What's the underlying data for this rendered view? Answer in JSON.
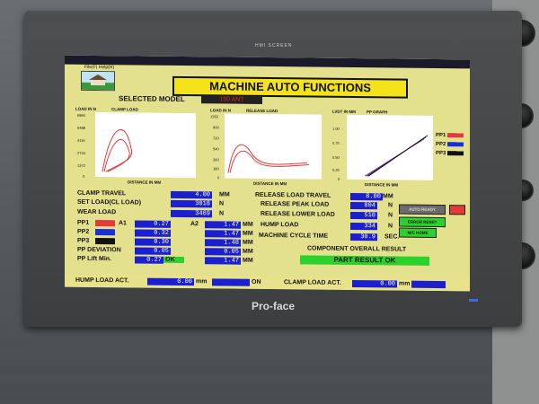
{
  "bezel_label": "HMI SCREEN",
  "brand": "Pro-face",
  "menu": "File(F)   Help(H)",
  "title": "MACHINE AUTO FUNCTIONS",
  "selected_model": {
    "label": "SELECTED MODEL",
    "value": "150 ANT"
  },
  "charts": [
    {
      "label": "CLAMP LOAD",
      "y_unit": "LOAD IN N",
      "x_label": "DISTANCE IN MM",
      "ticks": [
        "6860",
        "5488",
        "4116",
        "2744",
        "1372",
        "0"
      ]
    },
    {
      "label": "RELEASE LOAD",
      "y_unit": "LOAD IN N",
      "x_label": "DISTANCE IN MM",
      "ticks": [
        "1350",
        "900",
        "720",
        "540",
        "360",
        "180",
        "0"
      ]
    },
    {
      "label": "PP GRAPH",
      "y_unit": "LVDT IN MM",
      "x_label": "DISTANCE IN MM",
      "ticks": [
        "1.00",
        "0.75",
        "0.50",
        "0.25",
        "0"
      ]
    }
  ],
  "pp_legend": [
    "PP1",
    "PP2",
    "PP3"
  ],
  "left_fields": [
    {
      "label": "CLAMP TRAVEL",
      "value": "4.00",
      "unit": "MM"
    },
    {
      "label": "SET LOAD(CL LOAD)",
      "value": "3018",
      "unit": "N"
    },
    {
      "label": "WEAR LOAD",
      "value": "3469",
      "unit": "N"
    }
  ],
  "pp_rows": [
    {
      "label": "PP1",
      "a_label": "A1",
      "a_value": "0.27",
      "b_label": "A2",
      "b_value": "1.47",
      "unit": "MM"
    },
    {
      "label": "PP2",
      "a_value": "0.32",
      "b_value": "1.47",
      "unit": "MM"
    },
    {
      "label": "PP3",
      "a_value": "0.30",
      "b_value": "1.48",
      "unit": "MM"
    }
  ],
  "pp_deviation": {
    "label": "PP DEVIATION",
    "value": "0.05",
    "value2": "0.05",
    "unit": "MM"
  },
  "pp_lift": {
    "label": "PP Lift Min.",
    "value": "0.27",
    "status": "OK",
    "value2": "1.47",
    "unit": "MM"
  },
  "right_fields": [
    {
      "label": "RELEASE LOAD TRAVEL",
      "value": "8.00",
      "unit": "MM"
    },
    {
      "label": "RELEASE PEAK LOAD",
      "value": "804",
      "unit": "N"
    },
    {
      "label": "RELEASE LOWER LOAD",
      "value": "510",
      "unit": "N"
    },
    {
      "label": "HUMP LOAD",
      "value": "334",
      "unit": "N"
    },
    {
      "label": "MACHINE CYCLE TIME",
      "value": "30.9",
      "unit": "SEC."
    }
  ],
  "buttons": {
    "auto_ready": "AUTO READY",
    "error_reset": "ERROR RESET",
    "mc_home": "M/C HOME"
  },
  "component_result": {
    "label": "COMPONENT OVERALL RESULT",
    "value": "PART RESULT OK"
  },
  "footer": {
    "hump_label": "HUMP LOAD ACT.",
    "hump_value": "0.00",
    "hump_unit": "mm",
    "hump_state": "ON",
    "clamp_label": "CLAMP LOAD ACT.",
    "clamp_value": "0.00",
    "clamp_unit": "mm"
  },
  "colors": {
    "screen_bg": "#e3e08e",
    "value_box": "#1b1fcf",
    "title_bg": "#f4e21b",
    "ok_green": "#2bd22b",
    "pp1": "#e33b3b",
    "pp2": "#1b2fd6",
    "pp3": "#111111"
  }
}
